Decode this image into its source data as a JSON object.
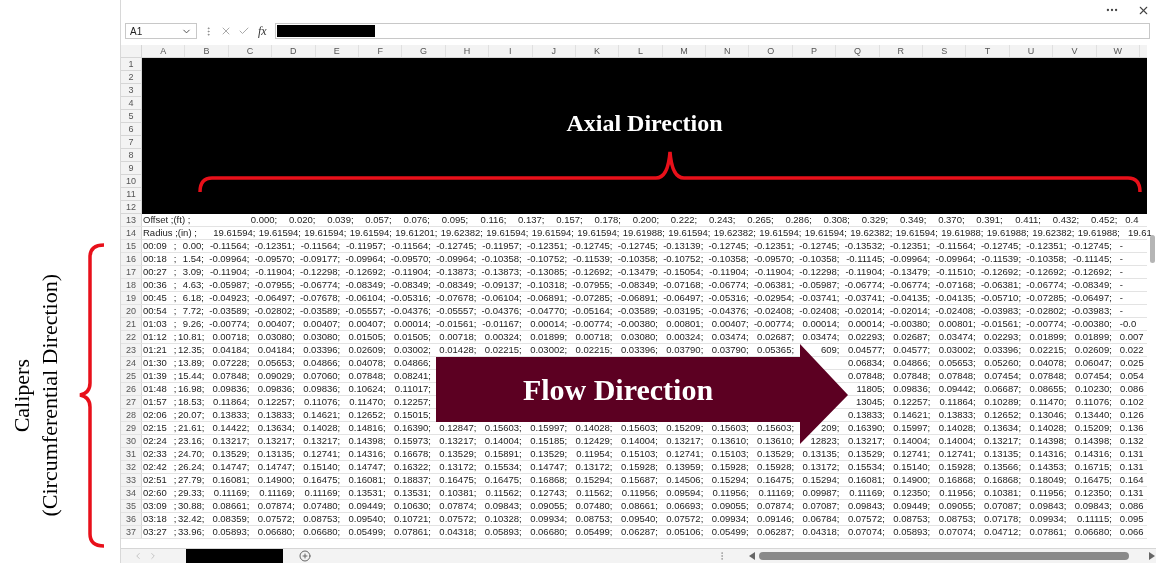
{
  "formula_bar": {
    "cell_ref": "A1",
    "function_label": "fx"
  },
  "columns": [
    "A",
    "B",
    "C",
    "D",
    "E",
    "F",
    "G",
    "H",
    "I",
    "J",
    "K",
    "L",
    "M",
    "N",
    "O",
    "P",
    "Q",
    "R",
    "S",
    "T",
    "U",
    "V",
    "W"
  ],
  "banner": {
    "rows": [
      "1",
      "2",
      "3",
      "4",
      "5",
      "6",
      "7",
      "8",
      "9",
      "10",
      "11",
      "12"
    ],
    "label": "Axial Direction"
  },
  "header_rows": [
    {
      "number": "13",
      "label": "Offset ;(ft) ;",
      "values": [
        "0.000;",
        "0.020;",
        "0.039;",
        "0.057;",
        "0.076;",
        "0.095;",
        "0.116;",
        "0.137;",
        "0.157;",
        "0.178;",
        "0.200;",
        "0.222;",
        "0.243;",
        "0.265;",
        "0.286;",
        "0.308;",
        "0.329;",
        "0.349;",
        "0.370;",
        "0.391;",
        "0.411;",
        "0.432;",
        "0.452;"
      ],
      "cut": "0.4"
    },
    {
      "number": "14",
      "label": "Radius ;(in) ;",
      "values": [
        "19.61594;",
        "19.61594;",
        "19.61594;",
        "19.61594;",
        "19.61201;",
        "19.62382;",
        "19.61594;",
        "19.61594;",
        "19.61594;",
        "19.61988;",
        "19.61594;",
        "19.62382;",
        "19.61594;",
        "19.61594;",
        "19.62382;",
        "19.61594;",
        "19.61988;",
        "19.61988;",
        "19.62382;",
        "19.61988;"
      ],
      "cut": "19.61"
    }
  ],
  "data_rows": [
    {
      "number": "15",
      "lead": [
        "00:09",
        ";",
        "0.00;"
      ],
      "values": [
        "-0.11564;",
        "-0.12351;",
        "-0.11564;",
        "-0.11957;",
        "-0.11564;",
        "-0.12745;",
        "-0.11957;",
        "-0.12351;",
        "-0.12745;",
        "-0.12745;",
        "-0.13139;",
        "-0.12745;",
        "-0.12351;",
        "-0.12745;",
        "-0.13532;",
        "-0.12351;",
        "-0.11564;",
        "-0.12745;",
        "-0.12351;",
        "-0.12745;"
      ],
      "cut": "-"
    },
    {
      "number": "16",
      "lead": [
        "00:18",
        ";",
        "1.54;"
      ],
      "values": [
        "-0.09964;",
        "-0.09570;",
        "-0.09177;",
        "-0.09964;",
        "-0.09570;",
        "-0.09964;",
        "-0.10358;",
        "-0.10752;",
        "-0.11539;",
        "-0.10358;",
        "-0.10752;",
        "-0.10358;",
        "-0.09570;",
        "-0.10358;",
        "-0.11145;",
        "-0.09964;",
        "-0.09964;",
        "-0.11539;",
        "-0.10358;",
        "-0.11145;"
      ],
      "cut": "-"
    },
    {
      "number": "17",
      "lead": [
        "00:27",
        ";",
        "3.09;"
      ],
      "values": [
        "-0.11904;",
        "-0.11904;",
        "-0.12298;",
        "-0.12692;",
        "-0.11904;",
        "-0.13873;",
        "-0.13873;",
        "-0.13085;",
        "-0.12692;",
        "-0.13479;",
        "-0.15054;",
        "-0.11904;",
        "-0.11904;",
        "-0.12298;",
        "-0.11904;",
        "-0.13479;",
        "-0.11510;",
        "-0.12692;",
        "-0.12692;",
        "-0.12692;"
      ],
      "cut": "-"
    },
    {
      "number": "18",
      "lead": [
        "00:36",
        ";",
        "4.63;"
      ],
      "values": [
        "-0.05987;",
        "-0.07955;",
        "-0.06774;",
        "-0.08349;",
        "-0.08349;",
        "-0.08349;",
        "-0.09137;",
        "-0.10318;",
        "-0.07955;",
        "-0.08349;",
        "-0.07168;",
        "-0.06774;",
        "-0.06381;",
        "-0.05987;",
        "-0.06774;",
        "-0.06774;",
        "-0.07168;",
        "-0.06381;",
        "-0.06774;",
        "-0.08349;"
      ],
      "cut": "-"
    },
    {
      "number": "19",
      "lead": [
        "00:45",
        ";",
        "6.18;"
      ],
      "values": [
        "-0.04923;",
        "-0.06497;",
        "-0.07678;",
        "-0.06104;",
        "-0.05316;",
        "-0.07678;",
        "-0.06104;",
        "-0.06891;",
        "-0.07285;",
        "-0.06891;",
        "-0.06497;",
        "-0.05316;",
        "-0.02954;",
        "-0.03741;",
        "-0.03741;",
        "-0.04135;",
        "-0.04135;",
        "-0.05710;",
        "-0.07285;",
        "-0.06497;"
      ],
      "cut": "-"
    },
    {
      "number": "20",
      "lead": [
        "00:54",
        ";",
        "7.72;"
      ],
      "values": [
        "-0.03589;",
        "-0.02802;",
        "-0.03589;",
        "-0.05557;",
        "-0.04376;",
        "-0.05557;",
        "-0.04376;",
        "-0.04770;",
        "-0.05164;",
        "-0.03589;",
        "-0.03195;",
        "-0.04376;",
        "-0.02408;",
        "-0.02408;",
        "-0.02014;",
        "-0.02014;",
        "-0.02408;",
        "-0.03983;",
        "-0.02802;",
        "-0.03983;"
      ],
      "cut": "-"
    },
    {
      "number": "21",
      "lead": [
        "01:03",
        ";",
        "9.26;"
      ],
      "values": [
        "-0.00774;",
        "0.00407;",
        "0.00407;",
        "0.00407;",
        "0.00014;",
        "-0.01561;",
        "-0.01167;",
        "0.00014;",
        "-0.00774;",
        "-0.00380;",
        "0.00801;",
        "0.00407;",
        "-0.00774;",
        "0.00014;",
        "0.00014;",
        "-0.00380;",
        "0.00801;",
        "-0.01561;",
        "-0.00774;",
        "-0.00380;"
      ],
      "cut": "-0.0"
    },
    {
      "number": "22",
      "lead": [
        "01:12",
        ";",
        "10.81;"
      ],
      "values": [
        "0.00718;",
        "0.03080;",
        "0.03080;",
        "0.01505;",
        "0.01505;",
        "0.00718;",
        "0.00324;",
        "0.01899;",
        "0.00718;",
        "0.03080;",
        "0.00324;",
        "0.03474;",
        "0.02687;",
        "0.03474;",
        "0.02293;",
        "0.02687;",
        "0.03474;",
        "0.02293;",
        "0.01899;",
        "0.01899;"
      ],
      "cut": "0.007"
    },
    {
      "number": "23",
      "lead": [
        "01:21",
        ";",
        "12.35;"
      ],
      "values": [
        "0.04184;",
        "0.04184;",
        "0.03396;",
        "0.02609;",
        "0.03002;",
        "0.01428;",
        "0.02215;",
        "0.03002;",
        "0.02215;",
        "0.03396;",
        "0.03790;",
        "0.03790;",
        "0.05365;"
      ],
      "values_right": [
        "609;",
        "0.04577;",
        "0.04577;",
        "0.03002;",
        "0.03396;",
        "0.02215;",
        "0.02609;"
      ],
      "cut": "0.022"
    },
    {
      "number": "24",
      "lead": [
        "01:30",
        ";",
        "13.89;"
      ],
      "values": [
        "0.07228;",
        "0.05653;",
        "0.04866;",
        "0.04078;",
        "0.04866;"
      ],
      "values_right": [
        "0.06834;",
        "0.04866;",
        "0.05653;",
        "0.05260;",
        "0.04078;",
        "0.06047;"
      ],
      "cut": "0.025"
    },
    {
      "number": "25",
      "lead": [
        "01:39",
        ";",
        "15.44;"
      ],
      "values": [
        "0.07848;",
        "0.09029;",
        "0.07060;",
        "0.07848;",
        "0.08241;"
      ],
      "values_right": [
        "0.07848;",
        "0.07848;",
        "0.07848;",
        "0.07454;",
        "0.07848;",
        "0.07454;"
      ],
      "cut": "0.054"
    },
    {
      "number": "26",
      "lead": [
        "01:48",
        ";",
        "16.98;"
      ],
      "values": [
        "0.09836;",
        "0.09836;",
        "0.09836;",
        "0.10624;",
        "0.11017;"
      ],
      "values_right": [
        "11805;",
        "0.09836;",
        "0.09442;",
        "0.06687;",
        "0.08655;",
        "0.10230;"
      ],
      "cut": "0.086"
    },
    {
      "number": "27",
      "lead": [
        "01:57",
        ";",
        "18.53;"
      ],
      "values": [
        "0.11864;",
        "0.12257;",
        "0.11076;",
        "0.11470;",
        "0.12257;"
      ],
      "values_right": [
        "13045;",
        "0.12257;",
        "0.11864;",
        "0.10289;",
        "0.11470;",
        "0.11076;"
      ],
      "cut": "0.102"
    },
    {
      "number": "28",
      "lead": [
        "02:06",
        ";",
        "20.07;"
      ],
      "values": [
        "0.13833;",
        "0.13833;",
        "0.14621;",
        "0.12652;",
        "0.15015;"
      ],
      "values_right": [
        "0.13833;",
        "0.14621;",
        "0.13833;",
        "0.12652;",
        "0.13046;",
        "0.13440;"
      ],
      "cut": "0.126"
    },
    {
      "number": "29",
      "lead": [
        "02:15",
        ";",
        "21.61;"
      ],
      "values": [
        "0.14422;",
        "0.13634;",
        "0.14028;",
        "0.14816;",
        "0.16390;",
        "0.12847;",
        "0.15603;",
        "0.15997;",
        "0.14028;",
        "0.15603;",
        "0.15209;",
        "0.15603;",
        "0.15603;"
      ],
      "values_right": [
        "209;",
        "0.16390;",
        "0.15997;",
        "0.14028;",
        "0.13634;",
        "0.14028;",
        "0.15209;"
      ],
      "cut": "0.136"
    },
    {
      "number": "30",
      "lead": [
        "02:24",
        ";",
        "23.16;"
      ],
      "values": [
        "0.13217;",
        "0.13217;",
        "0.13217;",
        "0.14398;",
        "0.15973;",
        "0.13217;",
        "0.14004;",
        "0.15185;",
        "0.12429;",
        "0.14004;",
        "0.13217;",
        "0.13610;",
        "0.13610;"
      ],
      "values_right": [
        "12823;",
        "0.13217;",
        "0.14004;",
        "0.14004;",
        "0.13217;",
        "0.14398;",
        "0.14398;"
      ],
      "cut": "0.132"
    },
    {
      "number": "31",
      "lead": [
        "02:33",
        ";",
        "24.70;"
      ],
      "values": [
        "0.13529;",
        "0.13135;",
        "0.12741;",
        "0.14316;",
        "0.16678;",
        "0.13529;",
        "0.15891;",
        "0.13529;",
        "0.11954;",
        "0.15103;",
        "0.12741;",
        "0.15103;",
        "0.13529;",
        "0.13135;",
        "0.13529;",
        "0.12741;",
        "0.12741;",
        "0.13135;",
        "0.14316;",
        "0.14316;"
      ],
      "cut": "0.131"
    },
    {
      "number": "32",
      "lead": [
        "02:42",
        ";",
        "26.24;"
      ],
      "values": [
        "0.14747;",
        "0.14747;",
        "0.15140;",
        "0.14747;",
        "0.16322;",
        "0.13172;",
        "0.15534;",
        "0.14747;",
        "0.13172;",
        "0.15928;",
        "0.13959;",
        "0.15928;",
        "0.15928;",
        "0.13172;",
        "0.15534;",
        "0.15140;",
        "0.15928;",
        "0.13566;",
        "0.14353;",
        "0.16715;"
      ],
      "cut": "0.131"
    },
    {
      "number": "33",
      "lead": [
        "02:51",
        ";",
        "27.79;"
      ],
      "values": [
        "0.16081;",
        "0.14900;",
        "0.16475;",
        "0.16081;",
        "0.18837;",
        "0.16475;",
        "0.16475;",
        "0.16868;",
        "0.15294;",
        "0.15687;",
        "0.14506;",
        "0.15294;",
        "0.16475;",
        "0.15294;",
        "0.16081;",
        "0.14900;",
        "0.16868;",
        "0.16868;",
        "0.18049;",
        "0.16475;"
      ],
      "cut": "0.164"
    },
    {
      "number": "34",
      "lead": [
        "02:60",
        ";",
        "29.33;"
      ],
      "values": [
        "0.11169;",
        "0.11169;",
        "0.11169;",
        "0.13531;",
        "0.13531;",
        "0.10381;",
        "0.11562;",
        "0.12743;",
        "0.11562;",
        "0.11956;",
        "0.09594;",
        "0.11956;",
        "0.11169;",
        "0.09987;",
        "0.11169;",
        "0.12350;",
        "0.11956;",
        "0.10381;",
        "0.11956;",
        "0.12350;"
      ],
      "cut": "0.131"
    },
    {
      "number": "35",
      "lead": [
        "03:09",
        ";",
        "30.88;"
      ],
      "values": [
        "0.08661;",
        "0.07874;",
        "0.07480;",
        "0.09449;",
        "0.10630;",
        "0.07874;",
        "0.09843;",
        "0.09055;",
        "0.07480;",
        "0.08661;",
        "0.06693;",
        "0.09055;",
        "0.07874;",
        "0.07087;",
        "0.09843;",
        "0.09449;",
        "0.09055;",
        "0.07087;",
        "0.09843;",
        "0.09843;"
      ],
      "cut": "0.086"
    },
    {
      "number": "36",
      "lead": [
        "03:18",
        ";",
        "32.42;"
      ],
      "values": [
        "0.08359;",
        "0.07572;",
        "0.08753;",
        "0.09540;",
        "0.10721;",
        "0.07572;",
        "0.10328;",
        "0.09934;",
        "0.08753;",
        "0.09540;",
        "0.07572;",
        "0.09934;",
        "0.09146;",
        "0.06784;",
        "0.07572;",
        "0.08753;",
        "0.08753;",
        "0.07178;",
        "0.09934;",
        "0.11115;"
      ],
      "cut": "0.095"
    },
    {
      "number": "37",
      "lead": [
        "03:27",
        ";",
        "33.96;"
      ],
      "values": [
        "0.05893;",
        "0.06680;",
        "0.06680;",
        "0.05499;",
        "0.07861;",
        "0.04318;",
        "0.05893;",
        "0.06680;",
        "0.05499;",
        "0.06287;",
        "0.05106;",
        "0.05499;",
        "0.06287;",
        "0.04318;",
        "0.07074;",
        "0.05893;",
        "0.07074;",
        "0.04712;",
        "0.07861;",
        "0.06680;"
      ],
      "cut": "0.066"
    }
  ],
  "flow_arrow": {
    "label": "Flow Direction"
  },
  "side_label": {
    "lines": [
      "Calipers",
      "(Circumferential Direction)"
    ]
  }
}
